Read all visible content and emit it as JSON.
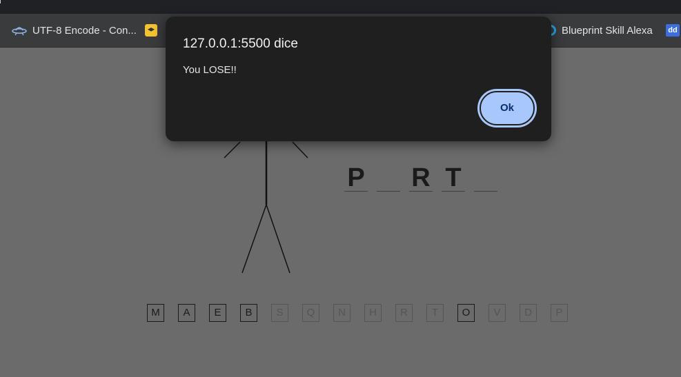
{
  "bookmarks": [
    {
      "label": "UTF-8 Encode - Con...",
      "icon": "ufo-icon"
    },
    {
      "label": "",
      "icon": "layers-icon"
    },
    {
      "label": "Blueprint Skill Alexa",
      "icon": "alexa-ring-icon"
    },
    {
      "label": "dd",
      "icon": "dd-icon"
    }
  ],
  "game": {
    "word_slots": [
      "P",
      "",
      "R",
      "T",
      ""
    ],
    "letters": [
      {
        "letter": "M",
        "used": true
      },
      {
        "letter": "A",
        "used": true
      },
      {
        "letter": "E",
        "used": true
      },
      {
        "letter": "B",
        "used": true
      },
      {
        "letter": "S",
        "used": false
      },
      {
        "letter": "Q",
        "used": false
      },
      {
        "letter": "N",
        "used": false
      },
      {
        "letter": "H",
        "used": false
      },
      {
        "letter": "R",
        "used": false
      },
      {
        "letter": "T",
        "used": false
      },
      {
        "letter": "O",
        "used": true
      },
      {
        "letter": "V",
        "used": false
      },
      {
        "letter": "D",
        "used": false
      },
      {
        "letter": "P",
        "used": false
      }
    ]
  },
  "dialog": {
    "title": "127.0.0.1:5500 dice",
    "message": "You LOSE!!",
    "ok_label": "Ok"
  },
  "colors": {
    "accent": "#a8c7fa",
    "dialog_bg": "#1f1f1f",
    "page_dim": "#6b6b6b"
  }
}
